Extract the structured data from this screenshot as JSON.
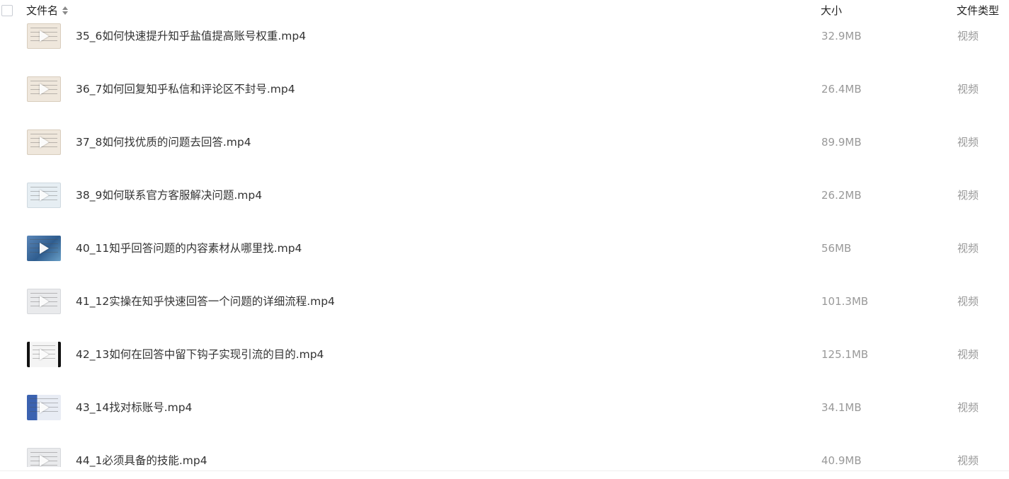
{
  "header": {
    "name_label": "文件名",
    "size_label": "大小",
    "type_label": "文件类型"
  },
  "rows": [
    {
      "name": "35_6如何快速提升知乎盐值提高账号权重.mp4",
      "size": "32.9MB",
      "type": "视频",
      "thumb": "beige"
    },
    {
      "name": "36_7如何回复知乎私信和评论区不封号.mp4",
      "size": "26.4MB",
      "type": "视频",
      "thumb": "beige"
    },
    {
      "name": "37_8如何找优质的问题去回答.mp4",
      "size": "89.9MB",
      "type": "视频",
      "thumb": "beige"
    },
    {
      "name": "38_9如何联系官方客服解决问题.mp4",
      "size": "26.2MB",
      "type": "视频",
      "thumb": "avatar"
    },
    {
      "name": "40_11知乎回答问题的内容素材从哪里找.mp4",
      "size": "56MB",
      "type": "视频",
      "thumb": "blue"
    },
    {
      "name": "41_12实操在知乎快速回答一个问题的详细流程.mp4",
      "size": "101.3MB",
      "type": "视频",
      "thumb": "light"
    },
    {
      "name": "42_13如何在回答中留下钩子实现引流的目的.mp4",
      "size": "125.1MB",
      "type": "视频",
      "thumb": "dark"
    },
    {
      "name": "43_14找对标账号.mp4",
      "size": "34.1MB",
      "type": "视频",
      "thumb": "bluelight"
    },
    {
      "name": "44_1必须具备的技能.mp4",
      "size": "40.9MB",
      "type": "视频",
      "thumb": "light"
    }
  ]
}
